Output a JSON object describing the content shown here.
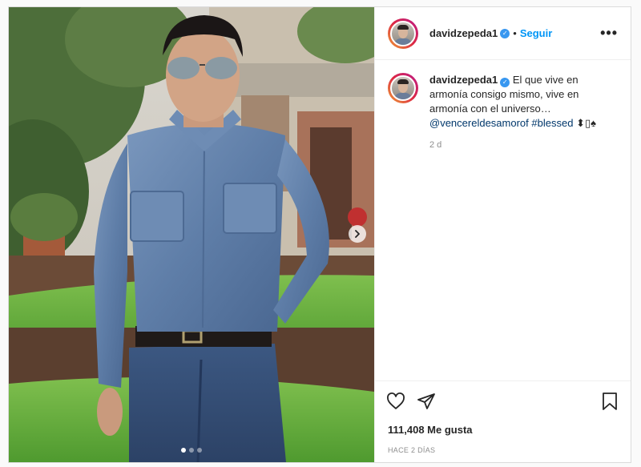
{
  "post": {
    "username": "davidzepeda1",
    "verified_icon": "verified-badge-icon",
    "separator": "•",
    "follow_label": "Seguir",
    "more_icon": "more-options-icon",
    "more_label": "•••",
    "caption": {
      "username": "davidzepeda1",
      "text": "El que vive en armonía consigo mismo, vive en armonía con el universo…",
      "mention": "@vencereldesamorof",
      "hashtag": "#blessed",
      "emoji": "⬍▯♠"
    },
    "caption_age": "2 d",
    "likes": "111,408 Me gusta",
    "posted": "HACE 2 DÍAS",
    "carousel": {
      "current": 1,
      "total": 3
    },
    "colors": {
      "accent": "#0095f6",
      "verified": "#3897f0",
      "mention": "#00376b"
    }
  }
}
